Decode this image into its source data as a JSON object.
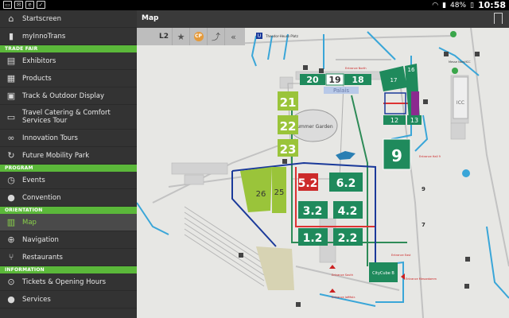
{
  "status": {
    "battery": "48%",
    "clock": "10:58"
  },
  "header": {
    "title": "Map"
  },
  "toolbar": {
    "level": "L2",
    "cp": "CP"
  },
  "sidebar": {
    "items_top": [
      {
        "label": "Startscreen",
        "icon": "home-icon"
      },
      {
        "label": "myInnoTrans",
        "icon": "bookmark-icon"
      }
    ],
    "sections": [
      {
        "title": "TRADE FAIR",
        "items": [
          {
            "label": "Exhibitors",
            "icon": "exhibitors-icon"
          },
          {
            "label": "Products",
            "icon": "products-icon"
          },
          {
            "label": "Track & Outdoor Display",
            "icon": "train-icon"
          },
          {
            "label": "Travel Catering & Comfort Services Tour",
            "icon": "catering-icon"
          },
          {
            "label": "Innovation Tours",
            "icon": "glasses-icon"
          },
          {
            "label": "Future Mobility Park",
            "icon": "mobility-icon"
          }
        ]
      },
      {
        "title": "PROGRAM",
        "items": [
          {
            "label": "Events",
            "icon": "clock-icon"
          },
          {
            "label": "Convention",
            "icon": "speech-icon"
          }
        ]
      },
      {
        "title": "ORIENTATION",
        "items": [
          {
            "label": "Map",
            "icon": "map-icon",
            "active": true
          },
          {
            "label": "Navigation",
            "icon": "navigation-icon"
          },
          {
            "label": "Restaurants",
            "icon": "cutlery-icon"
          }
        ]
      },
      {
        "title": "INFORMATION",
        "items": [
          {
            "label": "Tickets & Opening Hours",
            "icon": "ticket-icon"
          },
          {
            "label": "Services",
            "icon": "services-icon"
          }
        ]
      }
    ]
  },
  "map": {
    "halls": {
      "h20": "20",
      "h19": "19",
      "h18": "18",
      "h17": "17",
      "h16": "16",
      "h12": "12",
      "h13": "13",
      "h21": "21",
      "h22": "22",
      "h23": "23",
      "h9": "9",
      "h26": "26",
      "h25": "25",
      "h52": "5.2",
      "h62": "6.2",
      "h32": "3.2",
      "h42": "4.2",
      "h12b": "1.2",
      "h22b": "2.2"
    },
    "labels": {
      "palais": "Palais",
      "summer_garden": "Summer Garden",
      "theodor_heuss_platz": "Theodor-Heuss-Platz",
      "icc": "ICC",
      "city_cube": "CityCube B",
      "entrance_north": "Entrance North",
      "entrance_hall9": "Entrance Hall 9",
      "entrance_south": "Entrance South",
      "entrance_messedamm": "Entrance Messedamm",
      "entrance_jafféstr": "Entrance Jafféstr.",
      "entrance_east": "Entrance East",
      "messe_nord": "Messe Nord/ICC",
      "small_9": "9",
      "small_7": "7"
    }
  }
}
